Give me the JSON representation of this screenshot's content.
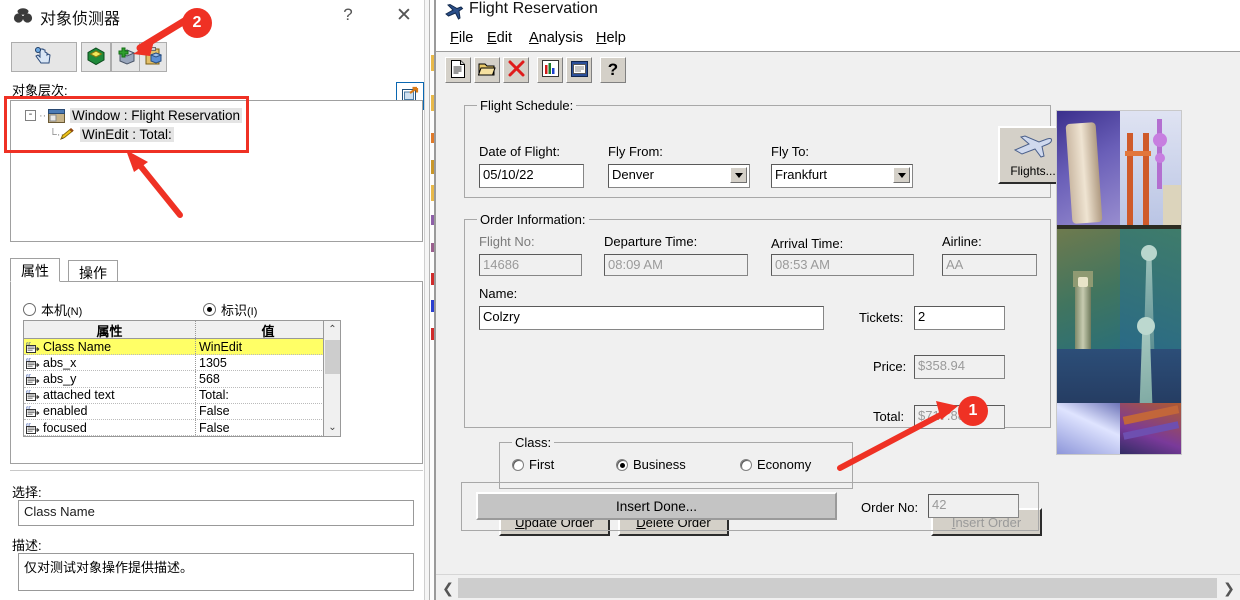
{
  "spy": {
    "title": "对象侦测器",
    "title_icon": "spy-icon",
    "help_label": "?",
    "close_label": "✕",
    "toolbar": [
      {
        "name": "pointer-hand-tool",
        "icon": "hand-pointer-icon"
      },
      {
        "name": "object-tool",
        "icon": "green-cube-icon"
      },
      {
        "name": "add-object-tool",
        "icon": "add-cube-icon"
      },
      {
        "name": "copy-object-tool",
        "icon": "clipboard-cube-icon"
      }
    ],
    "export_button": {
      "name": "export-to-repository-button",
      "icon": "export-icon"
    },
    "hierarchy_label": "对象层次:",
    "tree": [
      {
        "toggle": "-",
        "icon": "window-icon",
        "text": "Window : Flight Reservation"
      },
      {
        "toggle": "",
        "icon": "pencil-icon",
        "text": "WinEdit : Total:"
      }
    ],
    "tabs": [
      {
        "label": "属性",
        "active": true
      },
      {
        "label": "操作",
        "active": false
      }
    ],
    "radios": [
      {
        "label": "本机",
        "mnemonic": "(N)",
        "selected": false
      },
      {
        "label": "标识",
        "mnemonic": "(I)",
        "selected": true
      }
    ],
    "table": {
      "columns": [
        "属性",
        "值"
      ],
      "rows": [
        {
          "name": "Class Name",
          "value": "WinEdit",
          "selected": true
        },
        {
          "name": "abs_x",
          "value": "1305",
          "selected": false
        },
        {
          "name": "abs_y",
          "value": "568",
          "selected": false
        },
        {
          "name": "attached text",
          "value": "Total:",
          "selected": false
        },
        {
          "name": "enabled",
          "value": "False",
          "selected": false
        },
        {
          "name": "focused",
          "value": "False",
          "selected": false
        }
      ],
      "scroll_up": "⌃",
      "scroll_down": "⌄"
    },
    "selection_label": "选择:",
    "selection_value": "Class Name",
    "description_label": "描述:",
    "description_value": "仅对测试对象操作提供描述。"
  },
  "flight": {
    "title": "Flight Reservation",
    "title_icon": "airplane-icon",
    "caption_buttons": {
      "minimize": "—",
      "maximize": "☐",
      "close": "✕"
    },
    "menus": [
      {
        "head": "F",
        "rest": "ile"
      },
      {
        "head": "E",
        "rest": "dit"
      },
      {
        "head": "A",
        "rest": "nalysis"
      },
      {
        "head": "H",
        "rest": "elp"
      }
    ],
    "toolbar": [
      {
        "name": "new-order-button",
        "icon": "document-icon"
      },
      {
        "name": "open-order-button",
        "icon": "open-folder-icon"
      },
      {
        "name": "delete-order-button",
        "icon": "red-x-icon"
      },
      {
        "name": "graph-button",
        "icon": "bar-chart-icon"
      },
      {
        "name": "report-button",
        "icon": "report-icon"
      },
      {
        "name": "help-button",
        "icon": "question-mark-icon"
      }
    ],
    "schedule": {
      "group_title": "Flight Schedule:",
      "date_label": "Date of Flight:",
      "date_value": "05/10/22",
      "from_label": "Fly From:",
      "from_value": "Denver",
      "to_label": "Fly To:",
      "to_value": "Frankfurt",
      "flights_button": "Flights..."
    },
    "order": {
      "group_title": "Order Information:",
      "flight_no_label": "Flight No:",
      "flight_no_value": "14686",
      "departure_label": "Departure Time:",
      "departure_value": "08:09 AM",
      "arrival_label": "Arrival Time:",
      "arrival_value": "08:53 AM",
      "airline_label": "Airline:",
      "airline_value": "AA",
      "name_label": "Name:",
      "name_value": "Colzry",
      "tickets_label": "Tickets:",
      "tickets_value": "2",
      "price_label": "Price:",
      "price_value": "$358.94",
      "total_label": "Total:",
      "total_value": "$717.88",
      "class_group_title": "Class:",
      "classes": [
        {
          "label": "First",
          "selected": false
        },
        {
          "label": "Business",
          "selected": true
        },
        {
          "label": "Economy",
          "selected": false
        }
      ],
      "update_button": {
        "head": "U",
        "rest": "pdate Order"
      },
      "delete_button": {
        "head": "D",
        "rest": "elete Order"
      },
      "insert_button": {
        "head": "I",
        "rest": "nsert Order"
      }
    },
    "bottom": {
      "insert_done": "Insert Done...",
      "order_no_label": "Order No:",
      "order_no_value": "42"
    },
    "hscroll": {
      "left": "❮",
      "right": "❯"
    },
    "collage_name": "travel-landmarks-collage"
  },
  "annotations": [
    {
      "id": "badge-2",
      "label": "2"
    },
    {
      "id": "badge-1",
      "label": "1"
    }
  ],
  "colors": {
    "accent_red": "#ef3124",
    "highlight_yellow": "#ffff66",
    "window_face": "#f0f0f0",
    "classic_face": "#d4d0c8"
  }
}
